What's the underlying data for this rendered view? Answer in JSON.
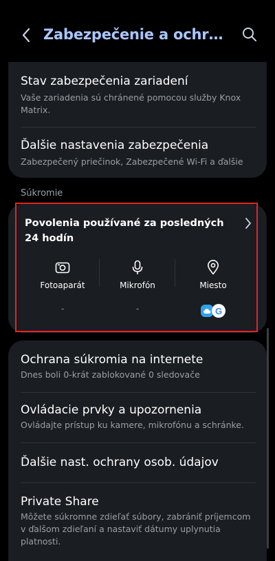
{
  "header": {
    "title": "Zabezpečenie a ochrana..."
  },
  "top_card": {
    "items": [
      {
        "title": "Stav zabezpečenia zariadení",
        "subtitle": "Vaše zariadenia sú chránené pomocou služby Knox Matrix."
      },
      {
        "title": "Ďalšie nastavenia zabezpečenia",
        "subtitle": "Zabezpečený priečinok, Zabezpečené Wi-Fi a ďalšie"
      }
    ]
  },
  "privacy": {
    "section_label": "Súkromie",
    "permissions_title": "Povolenia používané za posledných 24 hodín",
    "columns": [
      {
        "label": "Fotoaparát",
        "value": "-",
        "icon": "camera-icon"
      },
      {
        "label": "Mikrofón",
        "value": "-",
        "icon": "microphone-icon"
      },
      {
        "label": "Miesto",
        "value": "",
        "icon": "location-pin-icon",
        "apps": [
          "cloud-app-icon",
          "google-app-icon"
        ]
      }
    ],
    "google_letter": "G"
  },
  "bottom_card": {
    "items": [
      {
        "title": "Ochrana súkromia na internete",
        "subtitle": "Dnes boli 0-krát zablokované 0 sledovače"
      },
      {
        "title": "Ovládacie prvky a upozornenia",
        "subtitle": "Ovládajte prístup ku kamere, mikrofónu a schránke."
      },
      {
        "title": "Ďalšie nast. ochrany osob. údajov",
        "subtitle": ""
      },
      {
        "title": "Private Share",
        "subtitle": "Môžete súkromne zdieľať súbory, zabrániť príjemcom v ďalšom zdieľaní a nastaviť dátumy uplynutia platnosti."
      }
    ]
  },
  "colors": {
    "background": "#000000",
    "card": "#1a1d21",
    "title_accent": "#a9c7ff",
    "highlight": "#e3242b",
    "secondary_text": "#9aa0a8"
  }
}
